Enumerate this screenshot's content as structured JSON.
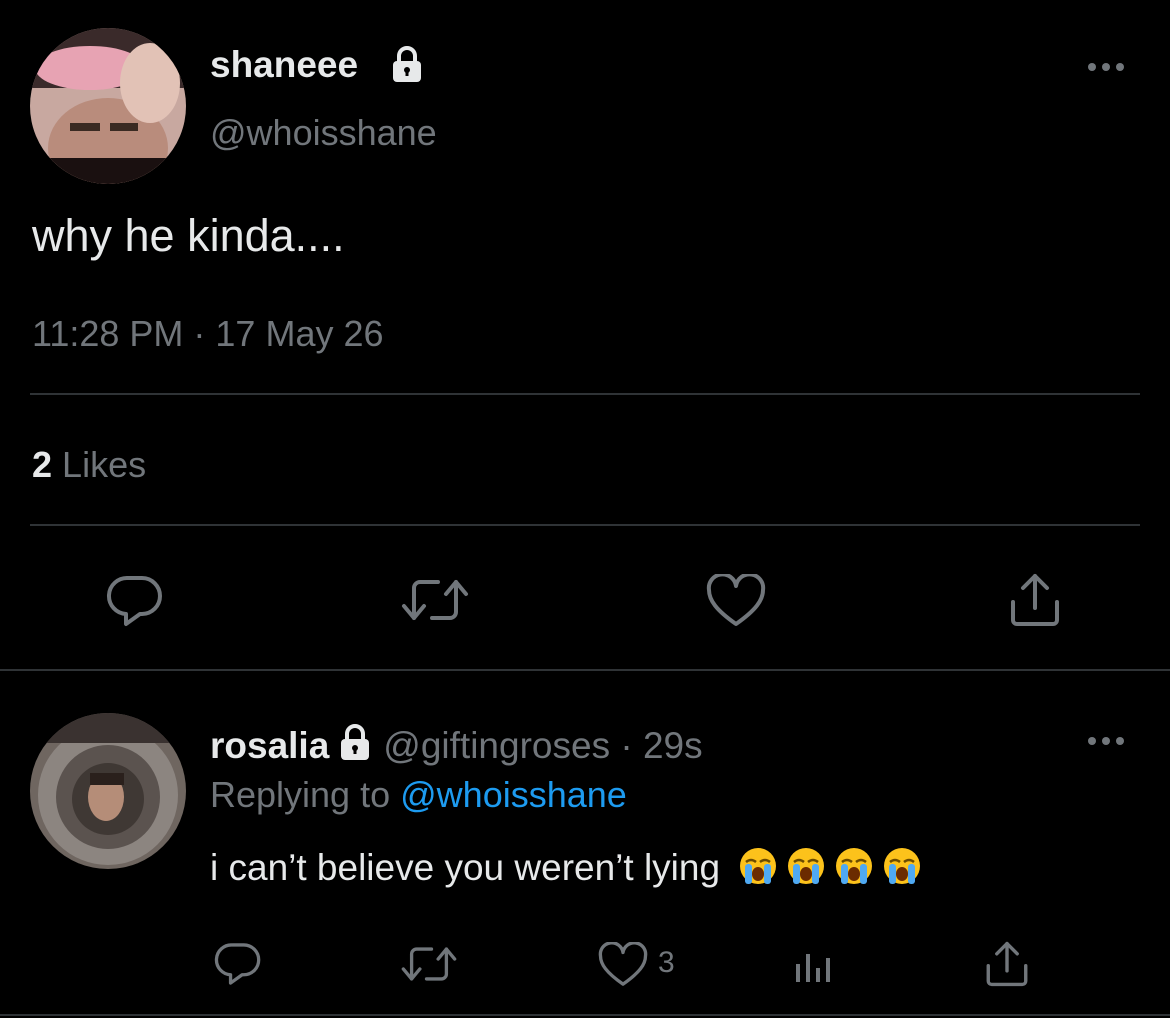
{
  "main_tweet": {
    "display_name": "shaneee",
    "handle": "@whoisshane",
    "text": "why he kinda....",
    "timestamp": "11:28 PM · 17 May 26",
    "likes_count": "2",
    "likes_label": "Likes",
    "protected": true,
    "actions": [
      "reply-icon",
      "retweet-icon",
      "like-icon",
      "share-icon"
    ]
  },
  "reply_tweet": {
    "display_name": "rosalia",
    "handle": "@giftingroses",
    "separator": " · ",
    "age": "29s",
    "replying_label": "Replying to",
    "replying_to": "@whoisshane",
    "text": "i can’t believe you weren’t lying",
    "emojis": [
      "loudly-crying-face",
      "loudly-crying-face",
      "loudly-crying-face",
      "loudly-crying-face"
    ],
    "like_count": "3",
    "protected": true,
    "actions": [
      "reply-icon",
      "retweet-icon",
      "like-icon",
      "analytics-icon",
      "share-icon"
    ]
  },
  "colors": {
    "background": "#000000",
    "text_primary": "#e7e9ea",
    "text_muted": "#71767b",
    "link": "#1d9bf0",
    "divider": "#2f3336"
  }
}
